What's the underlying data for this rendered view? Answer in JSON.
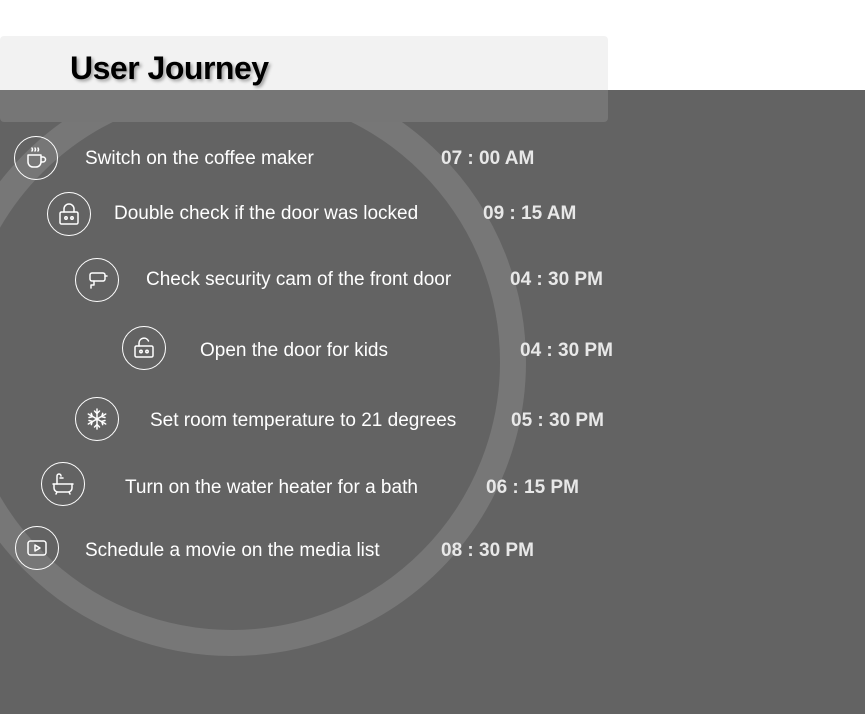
{
  "title": "User Journey",
  "steps": [
    {
      "icon": "coffee-cup-icon",
      "label": "Switch on the coffee maker",
      "time": "07 : 00 AM"
    },
    {
      "icon": "padlock-icon",
      "label": "Double check if the door was locked",
      "time": "09 : 15 AM"
    },
    {
      "icon": "security-camera-icon",
      "label": "Check security cam of the front door",
      "time": "04 : 30 PM"
    },
    {
      "icon": "unlocked-padlock-icon",
      "label": "Open the door for kids",
      "time": "04 : 30 PM"
    },
    {
      "icon": "snowflake-icon",
      "label": "Set room temperature to 21 degrees",
      "time": "05 : 30 PM"
    },
    {
      "icon": "bathtub-icon",
      "label": "Turn on the water heater for a bath",
      "time": "06 : 15 PM"
    },
    {
      "icon": "play-button-icon",
      "label": "Schedule a movie on the media list",
      "time": "08 : 30 PM"
    }
  ],
  "colors": {
    "background": "#636363",
    "title_card": "#f2f2f2",
    "text": "#ffffff"
  }
}
